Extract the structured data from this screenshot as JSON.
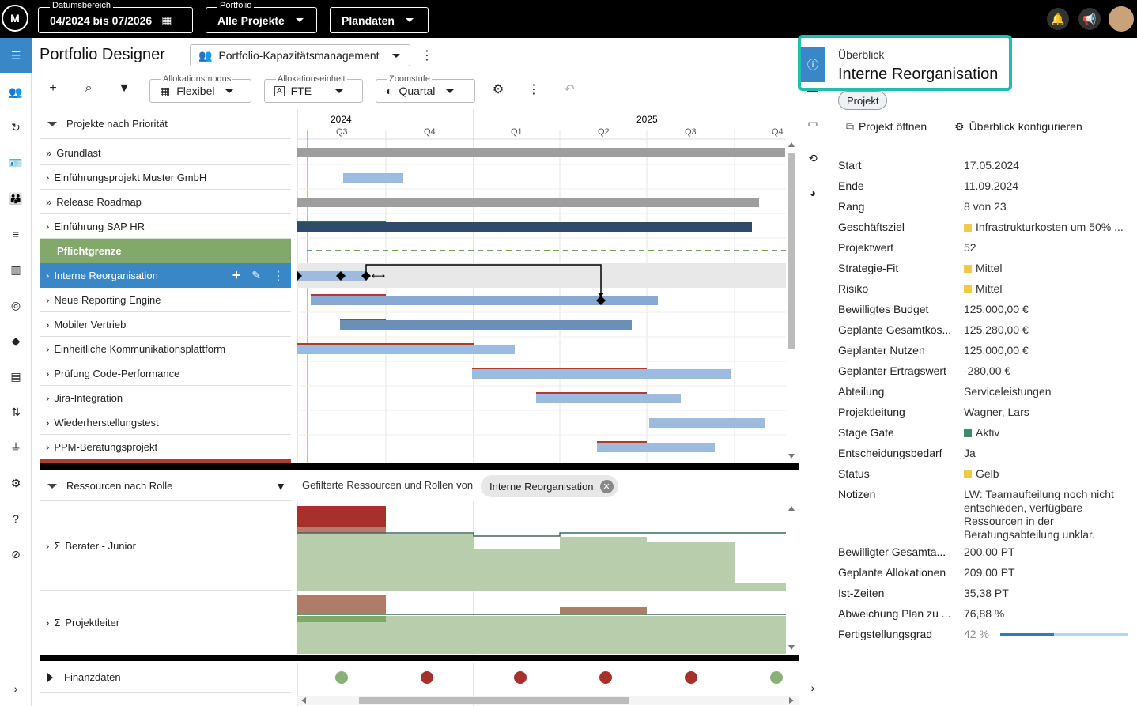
{
  "topbar": {
    "date_label": "Datumsbereich",
    "date_value": "04/2024 bis 07/2026",
    "portfolio_label": "Portfolio",
    "portfolio_value": "Alle Projekte",
    "plandaten_value": "Plandaten"
  },
  "header": {
    "title": "Portfolio Designer",
    "view_name": "Portfolio-Kapazitätsmanagement"
  },
  "toolbar": {
    "alloc_mode_label": "Allokationsmodus",
    "alloc_mode_value": "Flexibel",
    "alloc_unit_label": "Allokationseinheit",
    "alloc_unit_value": "FTE",
    "zoom_label": "Zoomstufe",
    "zoom_value": "Quartal"
  },
  "projects": {
    "group_title": "Projekte nach Priorität",
    "rows": [
      {
        "label": "Grundlast"
      },
      {
        "label": "Einführungsprojekt Muster GmbH"
      },
      {
        "label": "Release Roadmap"
      },
      {
        "label": "Einführung SAP HR"
      },
      {
        "label": "Pflichtgrenze"
      },
      {
        "label": "Interne Reorganisation"
      },
      {
        "label": "Neue Reporting Engine"
      },
      {
        "label": "Mobiler Vertrieb"
      },
      {
        "label": "Einheitliche Kommunikationsplattform"
      },
      {
        "label": "Prüfung Code-Performance"
      },
      {
        "label": "Jira-Integration"
      },
      {
        "label": "Wiederherstellungstest"
      },
      {
        "label": "PPM-Beratungsprojekt"
      }
    ]
  },
  "timeline": {
    "year_2024": "2024",
    "year_2025": "2025",
    "quarters": [
      "Q3",
      "Q4",
      "Q1",
      "Q2",
      "Q3",
      "Q4"
    ]
  },
  "resources": {
    "group_title": "Ressourcen nach Rolle",
    "filter_text": "Gefilterte Ressourcen und Rollen von",
    "filter_chip": "Interne Reorganisation",
    "rows": [
      {
        "label": "Berater - Junior"
      },
      {
        "label": "Projektleiter"
      }
    ],
    "finance_title": "Finanzdaten"
  },
  "overview": {
    "section": "Überblick",
    "title": "Interne Reorganisation",
    "chip": "Projekt",
    "open_project": "Projekt öffnen",
    "configure": "Überblick konfigurieren",
    "fields": [
      {
        "k": "Start",
        "v": "17.05.2024"
      },
      {
        "k": "Ende",
        "v": "11.09.2024"
      },
      {
        "k": "Rang",
        "v": "8 von 23"
      },
      {
        "k": "Geschäftsziel",
        "v": "Infrastrukturkosten um 50% ..."
      },
      {
        "k": "Projektwert",
        "v": "52"
      },
      {
        "k": "Strategie-Fit",
        "v": "Mittel"
      },
      {
        "k": "Risiko",
        "v": "Mittel"
      },
      {
        "k": "Bewilligtes Budget",
        "v": "125.000,00 €"
      },
      {
        "k": "Geplante Gesamtkos...",
        "v": "125.280,00 €"
      },
      {
        "k": "Geplanter Nutzen",
        "v": "125.000,00 €"
      },
      {
        "k": "Geplanter Ertragswert",
        "v": "-280,00 €"
      },
      {
        "k": "Abteilung",
        "v": "Serviceleistungen"
      },
      {
        "k": "Projektleitung",
        "v": "Wagner, Lars"
      },
      {
        "k": "Stage Gate",
        "v": "Aktiv"
      },
      {
        "k": "Entscheidungsbedarf",
        "v": "Ja"
      },
      {
        "k": "Status",
        "v": "Gelb"
      },
      {
        "k": "Notizen",
        "v": "LW: Teamaufteilung noch nicht entschieden, verfügbare Ressourcen in der Beratungsabteilung unklar."
      },
      {
        "k": "Bewilligter Gesamta...",
        "v": "200,00 PT"
      },
      {
        "k": "Geplante Allokationen",
        "v": "209,00 PT"
      },
      {
        "k": "Ist-Zeiten",
        "v": "35,38 PT"
      },
      {
        "k": "Abweichung Plan zu ...",
        "v": "76,88 %"
      },
      {
        "k": "Fertigstellungsgrad",
        "v": "42 %"
      }
    ],
    "progress": 0.42,
    "colors": {
      "yellow": "#f0c84a",
      "green": "#3f8a6a",
      "accent": "#1fbfae"
    }
  }
}
